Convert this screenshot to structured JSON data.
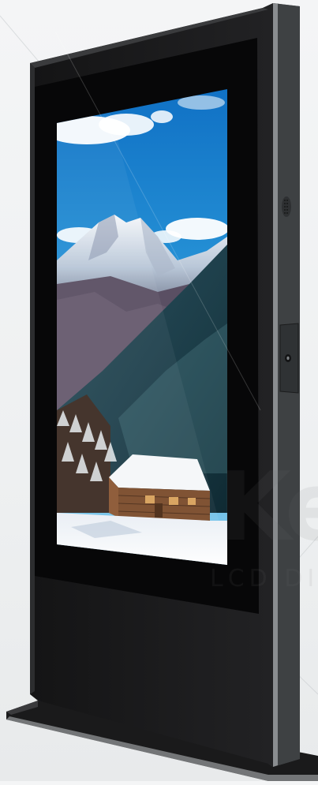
{
  "scene": {
    "subject": "outdoor-digital-signage-kiosk",
    "screen_content": "mountain-cabin-winter-landscape",
    "colors": {
      "background": "#f0f2f3",
      "kiosk_body": "#1c1c1e",
      "kiosk_side": "#5a5d60",
      "sky": "#1f8fd6",
      "snow": "#f4f7fa",
      "forest": "#1e3f4a"
    }
  },
  "watermark": {
    "brand": "Ke",
    "tagline": "LCD DIS"
  }
}
